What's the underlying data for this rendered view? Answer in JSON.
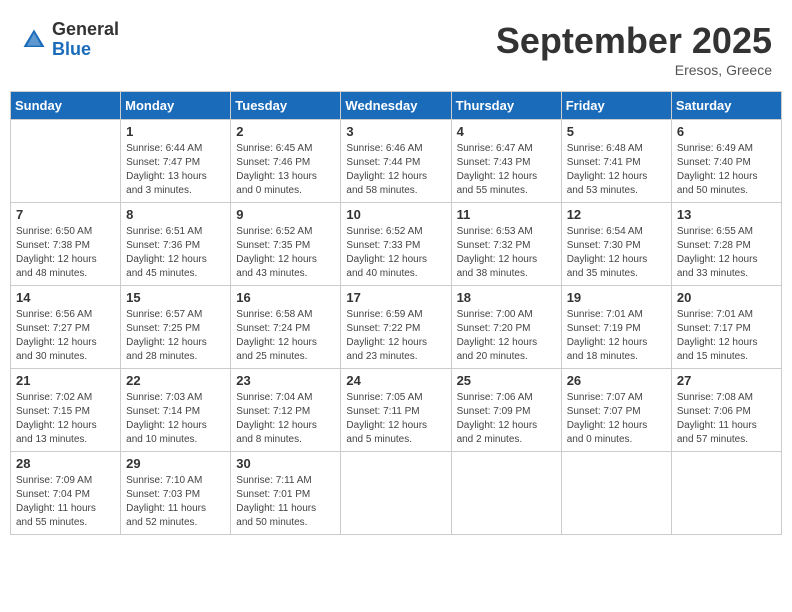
{
  "header": {
    "logo_general": "General",
    "logo_blue": "Blue",
    "month_title": "September 2025",
    "subtitle": "Eresos, Greece"
  },
  "days_of_week": [
    "Sunday",
    "Monday",
    "Tuesday",
    "Wednesday",
    "Thursday",
    "Friday",
    "Saturday"
  ],
  "weeks": [
    [
      {
        "day": "",
        "info": ""
      },
      {
        "day": "1",
        "info": "Sunrise: 6:44 AM\nSunset: 7:47 PM\nDaylight: 13 hours\nand 3 minutes."
      },
      {
        "day": "2",
        "info": "Sunrise: 6:45 AM\nSunset: 7:46 PM\nDaylight: 13 hours\nand 0 minutes."
      },
      {
        "day": "3",
        "info": "Sunrise: 6:46 AM\nSunset: 7:44 PM\nDaylight: 12 hours\nand 58 minutes."
      },
      {
        "day": "4",
        "info": "Sunrise: 6:47 AM\nSunset: 7:43 PM\nDaylight: 12 hours\nand 55 minutes."
      },
      {
        "day": "5",
        "info": "Sunrise: 6:48 AM\nSunset: 7:41 PM\nDaylight: 12 hours\nand 53 minutes."
      },
      {
        "day": "6",
        "info": "Sunrise: 6:49 AM\nSunset: 7:40 PM\nDaylight: 12 hours\nand 50 minutes."
      }
    ],
    [
      {
        "day": "7",
        "info": "Sunrise: 6:50 AM\nSunset: 7:38 PM\nDaylight: 12 hours\nand 48 minutes."
      },
      {
        "day": "8",
        "info": "Sunrise: 6:51 AM\nSunset: 7:36 PM\nDaylight: 12 hours\nand 45 minutes."
      },
      {
        "day": "9",
        "info": "Sunrise: 6:52 AM\nSunset: 7:35 PM\nDaylight: 12 hours\nand 43 minutes."
      },
      {
        "day": "10",
        "info": "Sunrise: 6:52 AM\nSunset: 7:33 PM\nDaylight: 12 hours\nand 40 minutes."
      },
      {
        "day": "11",
        "info": "Sunrise: 6:53 AM\nSunset: 7:32 PM\nDaylight: 12 hours\nand 38 minutes."
      },
      {
        "day": "12",
        "info": "Sunrise: 6:54 AM\nSunset: 7:30 PM\nDaylight: 12 hours\nand 35 minutes."
      },
      {
        "day": "13",
        "info": "Sunrise: 6:55 AM\nSunset: 7:28 PM\nDaylight: 12 hours\nand 33 minutes."
      }
    ],
    [
      {
        "day": "14",
        "info": "Sunrise: 6:56 AM\nSunset: 7:27 PM\nDaylight: 12 hours\nand 30 minutes."
      },
      {
        "day": "15",
        "info": "Sunrise: 6:57 AM\nSunset: 7:25 PM\nDaylight: 12 hours\nand 28 minutes."
      },
      {
        "day": "16",
        "info": "Sunrise: 6:58 AM\nSunset: 7:24 PM\nDaylight: 12 hours\nand 25 minutes."
      },
      {
        "day": "17",
        "info": "Sunrise: 6:59 AM\nSunset: 7:22 PM\nDaylight: 12 hours\nand 23 minutes."
      },
      {
        "day": "18",
        "info": "Sunrise: 7:00 AM\nSunset: 7:20 PM\nDaylight: 12 hours\nand 20 minutes."
      },
      {
        "day": "19",
        "info": "Sunrise: 7:01 AM\nSunset: 7:19 PM\nDaylight: 12 hours\nand 18 minutes."
      },
      {
        "day": "20",
        "info": "Sunrise: 7:01 AM\nSunset: 7:17 PM\nDaylight: 12 hours\nand 15 minutes."
      }
    ],
    [
      {
        "day": "21",
        "info": "Sunrise: 7:02 AM\nSunset: 7:15 PM\nDaylight: 12 hours\nand 13 minutes."
      },
      {
        "day": "22",
        "info": "Sunrise: 7:03 AM\nSunset: 7:14 PM\nDaylight: 12 hours\nand 10 minutes."
      },
      {
        "day": "23",
        "info": "Sunrise: 7:04 AM\nSunset: 7:12 PM\nDaylight: 12 hours\nand 8 minutes."
      },
      {
        "day": "24",
        "info": "Sunrise: 7:05 AM\nSunset: 7:11 PM\nDaylight: 12 hours\nand 5 minutes."
      },
      {
        "day": "25",
        "info": "Sunrise: 7:06 AM\nSunset: 7:09 PM\nDaylight: 12 hours\nand 2 minutes."
      },
      {
        "day": "26",
        "info": "Sunrise: 7:07 AM\nSunset: 7:07 PM\nDaylight: 12 hours\nand 0 minutes."
      },
      {
        "day": "27",
        "info": "Sunrise: 7:08 AM\nSunset: 7:06 PM\nDaylight: 11 hours\nand 57 minutes."
      }
    ],
    [
      {
        "day": "28",
        "info": "Sunrise: 7:09 AM\nSunset: 7:04 PM\nDaylight: 11 hours\nand 55 minutes."
      },
      {
        "day": "29",
        "info": "Sunrise: 7:10 AM\nSunset: 7:03 PM\nDaylight: 11 hours\nand 52 minutes."
      },
      {
        "day": "30",
        "info": "Sunrise: 7:11 AM\nSunset: 7:01 PM\nDaylight: 11 hours\nand 50 minutes."
      },
      {
        "day": "",
        "info": ""
      },
      {
        "day": "",
        "info": ""
      },
      {
        "day": "",
        "info": ""
      },
      {
        "day": "",
        "info": ""
      }
    ]
  ]
}
